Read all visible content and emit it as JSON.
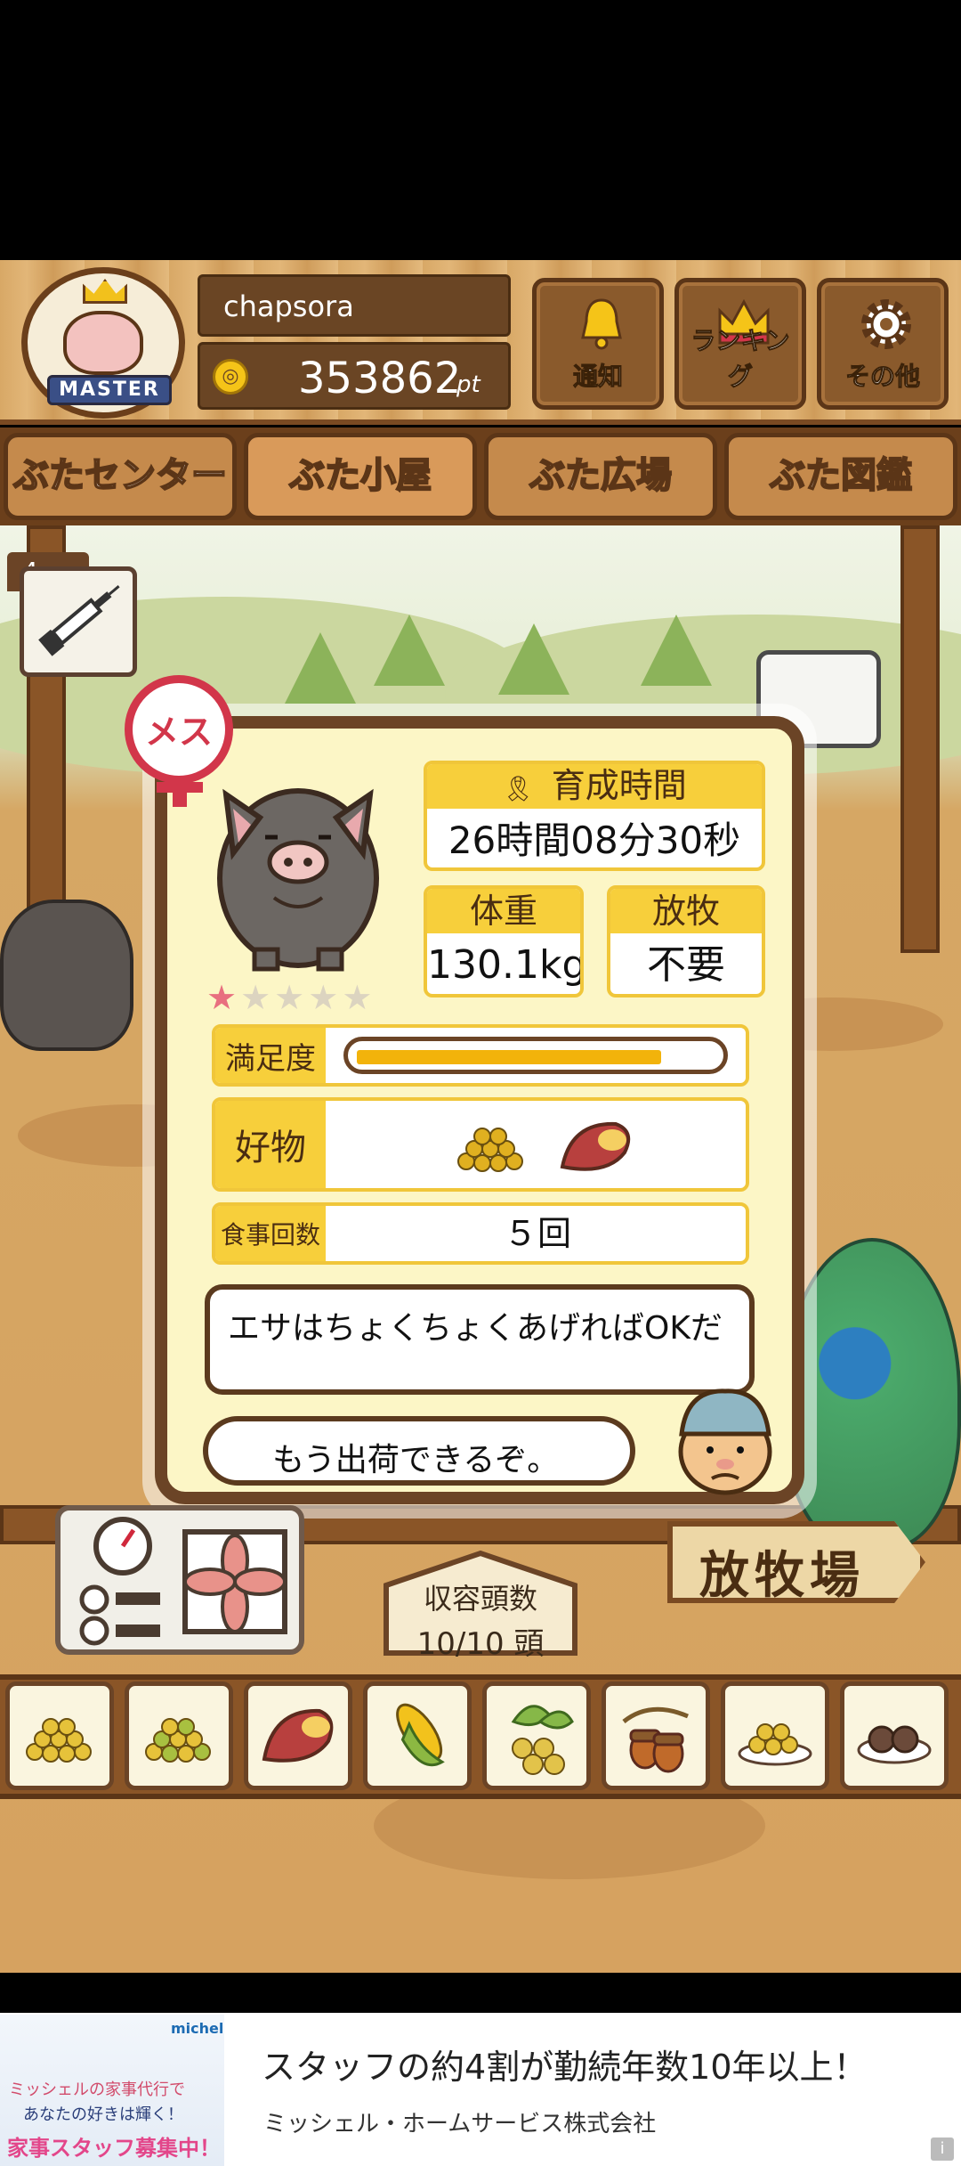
{
  "user": {
    "name": "chapsora",
    "points": "353862",
    "points_unit": "pt"
  },
  "badge": {
    "ribbon_text": "MASTER"
  },
  "header_buttons": [
    {
      "label": "通知",
      "icon": "bell-icon"
    },
    {
      "label": "ランキング",
      "icon": "crown-icon"
    },
    {
      "label": "その他",
      "icon": "gear-icon"
    }
  ],
  "tabs": [
    {
      "label": "ぶたセンター",
      "active": false
    },
    {
      "label": "ぶた小屋",
      "active": true
    },
    {
      "label": "ぶた広場",
      "active": false
    },
    {
      "label": "ぶた図鑑",
      "active": false
    }
  ],
  "side": {
    "syringe_count": "4"
  },
  "pig": {
    "gender": "メス",
    "rating": 1,
    "rating_max": 5,
    "raising_time_label": "育成時間",
    "raising_time": "26時間08分30秒",
    "weight_label": "体重",
    "weight": "130.1kg",
    "graze_label": "放牧",
    "graze": "不要",
    "satisfaction_label": "満足度",
    "satisfaction": 0.85,
    "favorite_label": "好物",
    "favorites": [
      "grain-icon",
      "sweet-potato-icon"
    ],
    "meals_label": "食事回数",
    "meals": "５回"
  },
  "dialogue": {
    "line1": "エサはちょくちょくあげればOKだ",
    "line2": "もう出荷できるぞ。"
  },
  "capacity": {
    "label": "収容頭数",
    "value": "10/10 頭"
  },
  "graze_sign": "放牧場",
  "foods": [
    "grain-pile-icon",
    "mixed-grain-icon",
    "sweet-potato-icon",
    "corn-icon",
    "soybean-icon",
    "acorn-icon",
    "rice-bowl-icon",
    "meat-plate-icon"
  ],
  "ad": {
    "title": "スタッフの約4割が勤続年数10年以上！",
    "subtitle": "ミッシェル・ホームサービス株式会社",
    "img_line1": "ミッシェルの家事代行で",
    "img_line2": "あなたの好きは輝く！",
    "img_line3": "家事スタッフ募集中！",
    "img_brand": "michell"
  }
}
